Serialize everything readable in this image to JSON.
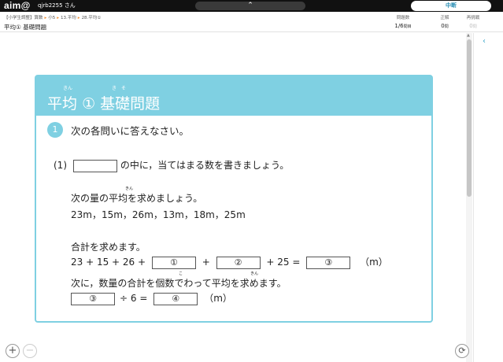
{
  "topbar": {
    "logo": "aim@",
    "user": "qjrb2255 さん",
    "collapse_icon": "chevron-up-icon",
    "suspend_label": "中断"
  },
  "info": {
    "breadcrumb": [
      "【小学生調整】算数",
      "小5",
      "13.平均",
      "28.平均①"
    ],
    "lesson_title": "平均① 基礎問題",
    "stats": [
      {
        "label": "問題数",
        "value": "1/6",
        "unit": "問目"
      },
      {
        "label": "正解",
        "value": "0",
        "unit": "問"
      },
      {
        "label": "再挑戦",
        "value": "0",
        "unit": "問"
      }
    ]
  },
  "card": {
    "title_main": "平均",
    "title_num": "①",
    "title_sub": "基礎問題",
    "ruby_heikin": "きん",
    "ruby_kiso": "き　そ",
    "question_number": "1",
    "question_text": "次の各問いに答えなさい。",
    "part_label": "(1)",
    "part_instruction": "の中に，当てはまる数を書きましょう。",
    "line_find_avg": "次の量の平均を求めましょう。",
    "ruby_avg": "きん",
    "values_line": "23m，15m，26m，13m，18m，25m",
    "line_sum": "合計を求めます。",
    "eq_prefix": "23 + 15 + 26 +",
    "plus1": "+",
    "plus2": "+ 25 =",
    "unit_m": "（m）",
    "blank1": "①",
    "blank2": "②",
    "blank3": "③",
    "blank4": "④",
    "line_next": "次に，数量の合計を個数でわって平均を求めます。",
    "ruby_ko": "こ",
    "ruby_kin2": "きん",
    "div_text": "÷ 6 =",
    "unit_m2": "（m）"
  },
  "controls": {
    "zoom_in": "+",
    "zoom_out": "−",
    "reset_icon": "refresh-icon",
    "sidebar_toggle": "‹"
  }
}
